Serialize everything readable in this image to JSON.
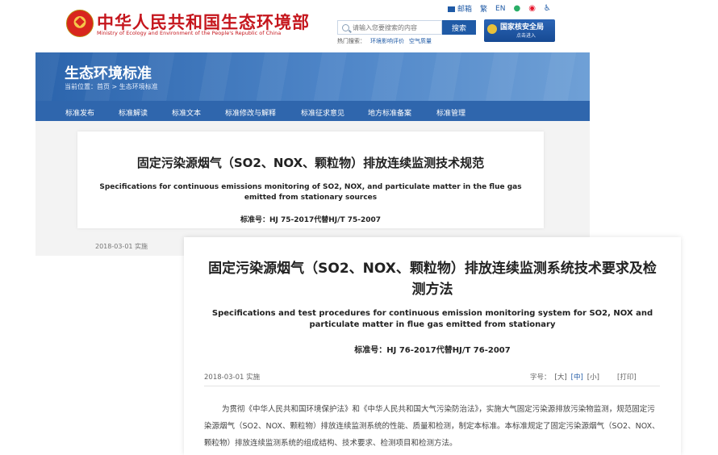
{
  "header": {
    "ministry_cn": "中华人民共和国生态环境部",
    "ministry_en": "Ministry of Ecology and Environment of the People's Republic of China",
    "top_links": {
      "mail": "邮箱",
      "traditional": "繁",
      "english": "EN"
    },
    "search": {
      "placeholder": "请输入您要搜索的内容",
      "button": "搜索"
    },
    "hot_search": {
      "label": "热门搜索：",
      "items": [
        "环境影响评价",
        "空气质量"
      ]
    },
    "nnsa": {
      "title": "国家核安全局",
      "sub": "点击进入"
    }
  },
  "banner": {
    "title": "生态环境标准",
    "breadcrumb": "当前位置：首页 > 生态环境标准"
  },
  "nav": {
    "items": [
      "标准发布",
      "标准解读",
      "标准文本",
      "标准修改与解释",
      "标准征求意见",
      "地方标准备案",
      "标准管理"
    ]
  },
  "card1": {
    "title": "固定污染源烟气（SO2、NOX、颗粒物）排放连续监测技术规范",
    "en_title": "Specifications for continuous emissions monitoring of SO2, NOX, and particulate matter in the flue gas emitted from stationary sources",
    "std_no": "标准号：HJ 75-2017代替HJ/T 75-2007",
    "date": "2018-03-01 实施"
  },
  "card2": {
    "title": "固定污染源烟气（SO2、NOX、颗粒物）排放连续监测系统技术要求及检测方法",
    "en_title": "Specifications and test procedures for continuous emission monitoring system for SO2, NOX and particulate matter in flue gas emitted from stationary",
    "std_no": "标准号：HJ 76-2017代替HJ/T 76-2007",
    "date": "2018-03-01 实施",
    "font_label": "字号：",
    "font_sizes": [
      "[大]",
      "[中]",
      "[小]"
    ],
    "print": "[打印]",
    "body": "为贯彻《中华人民共和国环境保护法》和《中华人民共和国大气污染防治法》，实施大气固定污染源排放污染物监测，规范固定污染源烟气（SO2、NOX、颗粒物）排放连续监测系统的性能、质量和检测，制定本标准。本标准规定了固定污染源烟气（SO2、NOX、颗粒物）排放连续监测系统的组成结构、技术要求、检测项目和检测方法。"
  },
  "colors": {
    "brand_red": "#c5161d",
    "nav_blue": "#2f66ad",
    "link_blue": "#1f5aa6"
  }
}
